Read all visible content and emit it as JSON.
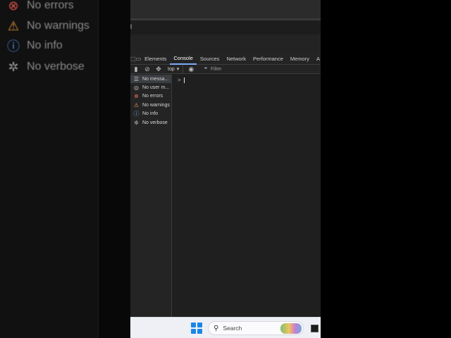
{
  "backdrop": {
    "items": [
      {
        "label": "No errors",
        "icon": "error-icon",
        "color": "#d9534f"
      },
      {
        "label": "No warnings",
        "icon": "warning-icon",
        "color": "#e39a3d"
      },
      {
        "label": "No info",
        "icon": "info-icon",
        "color": "#4f8de0"
      },
      {
        "label": "No verbose",
        "icon": "bug-icon",
        "color": "#9a9a9a"
      }
    ]
  },
  "window": {
    "title_fragment": "l"
  },
  "devtools": {
    "tabs": [
      {
        "label": "Elements",
        "active": false
      },
      {
        "label": "Console",
        "active": true
      },
      {
        "label": "Sources",
        "active": false
      },
      {
        "label": "Network",
        "active": false
      },
      {
        "label": "Performance",
        "active": false
      },
      {
        "label": "Memory",
        "active": false
      },
      {
        "label": "A",
        "active": false
      }
    ],
    "toolbar": {
      "context": "top",
      "filter_placeholder": "Filter"
    },
    "sidebar": {
      "items": [
        {
          "label": "No messa...",
          "icon": "list-icon",
          "color": "#cfcfcf",
          "selected": true
        },
        {
          "label": "No user m...",
          "icon": "user-icon",
          "color": "#cfcfcf",
          "selected": false
        },
        {
          "label": "No errors",
          "icon": "error-icon",
          "color": "#e46962",
          "selected": false
        },
        {
          "label": "No warnings",
          "icon": "warning-icon",
          "color": "#f29b4b",
          "selected": false
        },
        {
          "label": "No info",
          "icon": "info-icon",
          "color": "#7cacf8",
          "selected": false
        },
        {
          "label": "No verbose",
          "icon": "bug-icon",
          "color": "#bdbdbd",
          "selected": false
        }
      ]
    },
    "console": {
      "prompt": ">"
    }
  },
  "taskbar": {
    "search_placeholder": "Search",
    "accent": "#1a86e8"
  }
}
